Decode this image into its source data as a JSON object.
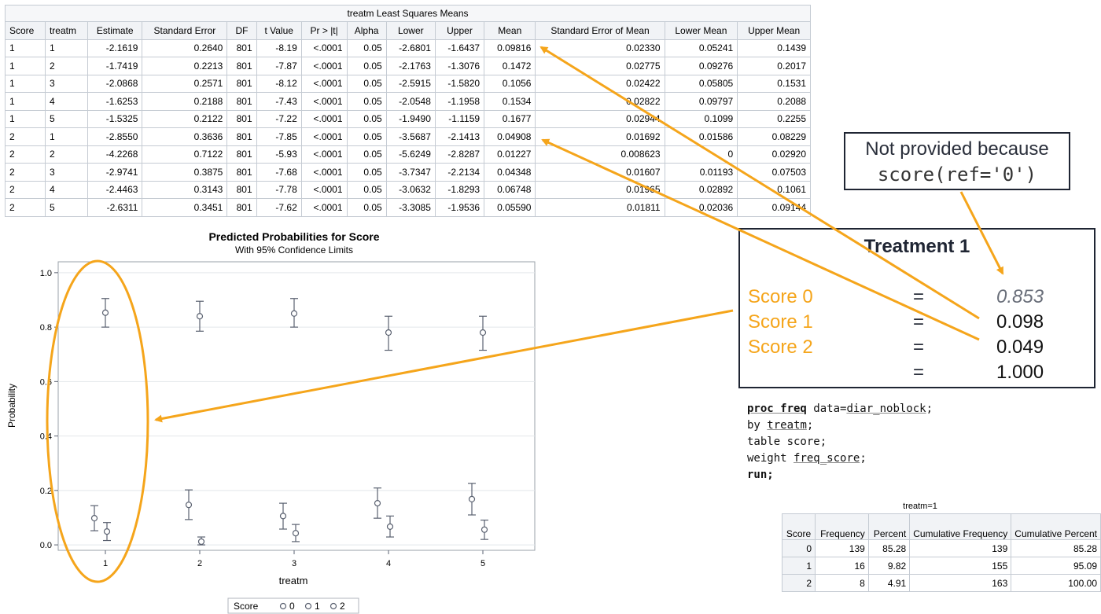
{
  "ls_table": {
    "title": "treatm Least Squares Means",
    "headers": [
      "Score",
      "treatm",
      "Estimate",
      "Standard Error",
      "DF",
      "t Value",
      "Pr > |t|",
      "Alpha",
      "Lower",
      "Upper",
      "Mean",
      "Standard Error of Mean",
      "Lower Mean",
      "Upper Mean"
    ],
    "rows": [
      [
        "1",
        "1",
        "-2.1619",
        "0.2640",
        "801",
        "-8.19",
        "<.0001",
        "0.05",
        "-2.6801",
        "-1.6437",
        "0.09816",
        "0.02330",
        "0.05241",
        "0.1439"
      ],
      [
        "1",
        "2",
        "-1.7419",
        "0.2213",
        "801",
        "-7.87",
        "<.0001",
        "0.05",
        "-2.1763",
        "-1.3076",
        "0.1472",
        "0.02775",
        "0.09276",
        "0.2017"
      ],
      [
        "1",
        "3",
        "-2.0868",
        "0.2571",
        "801",
        "-8.12",
        "<.0001",
        "0.05",
        "-2.5915",
        "-1.5820",
        "0.1056",
        "0.02422",
        "0.05805",
        "0.1531"
      ],
      [
        "1",
        "4",
        "-1.6253",
        "0.2188",
        "801",
        "-7.43",
        "<.0001",
        "0.05",
        "-2.0548",
        "-1.1958",
        "0.1534",
        "0.02822",
        "0.09797",
        "0.2088"
      ],
      [
        "1",
        "5",
        "-1.5325",
        "0.2122",
        "801",
        "-7.22",
        "<.0001",
        "0.05",
        "-1.9490",
        "-1.1159",
        "0.1677",
        "0.02944",
        "0.1099",
        "0.2255"
      ],
      [
        "2",
        "1",
        "-2.8550",
        "0.3636",
        "801",
        "-7.85",
        "<.0001",
        "0.05",
        "-3.5687",
        "-2.1413",
        "0.04908",
        "0.01692",
        "0.01586",
        "0.08229"
      ],
      [
        "2",
        "2",
        "-4.2268",
        "0.7122",
        "801",
        "-5.93",
        "<.0001",
        "0.05",
        "-5.6249",
        "-2.8287",
        "0.01227",
        "0.008623",
        "0",
        "0.02920"
      ],
      [
        "2",
        "3",
        "-2.9741",
        "0.3875",
        "801",
        "-7.68",
        "<.0001",
        "0.05",
        "-3.7347",
        "-2.2134",
        "0.04348",
        "0.01607",
        "0.01193",
        "0.07503"
      ],
      [
        "2",
        "4",
        "-2.4463",
        "0.3143",
        "801",
        "-7.78",
        "<.0001",
        "0.05",
        "-3.0632",
        "-1.8293",
        "0.06748",
        "0.01965",
        "0.02892",
        "0.1061"
      ],
      [
        "2",
        "5",
        "-2.6311",
        "0.3451",
        "801",
        "-7.62",
        "<.0001",
        "0.05",
        "-3.3085",
        "-1.9536",
        "0.05590",
        "0.01811",
        "0.02036",
        "0.09144"
      ]
    ]
  },
  "not_provided": {
    "line1": "Not provided because",
    "line2": "score(ref='0')"
  },
  "treatment_box": {
    "title": "Treatment 1",
    "rows": [
      {
        "label": "Score 0",
        "eq": "=",
        "value": "0.853"
      },
      {
        "label": "Score 1",
        "eq": "=",
        "value": "0.098"
      },
      {
        "label": "Score 2",
        "eq": "=",
        "value": "0.049"
      },
      {
        "label": "",
        "eq": "=",
        "value": "1.000"
      }
    ]
  },
  "code": {
    "line1_kw": "proc freq",
    "line1_rest": " data=",
    "line1_ds": "diar_noblock",
    "line1_end": ";",
    "line2_kw": "by ",
    "line2_var": "treatm",
    "line2_end": ";",
    "line3": "table score;",
    "line4_kw": "weight ",
    "line4_var": "freq_score",
    "line4_end": ";",
    "line5": "run;"
  },
  "freq_table": {
    "title": "treatm=1",
    "headers": [
      "Score",
      "Frequency",
      "Percent",
      "Cumulative Frequency",
      "Cumulative Percent"
    ],
    "rows": [
      [
        "0",
        "139",
        "85.28",
        "139",
        "85.28"
      ],
      [
        "1",
        "16",
        "9.82",
        "155",
        "95.09"
      ],
      [
        "2",
        "8",
        "4.91",
        "163",
        "100.00"
      ]
    ]
  },
  "colors": {
    "accent": "#f5a51b",
    "axis": "#5a6170",
    "border": "#c5cbd3"
  },
  "chart_data": {
    "type": "scatter",
    "title": "Predicted Probabilities for Score",
    "subtitle": "With 95% Confidence Limits",
    "xlabel": "treatm",
    "ylabel": "Probability",
    "categories": [
      "1",
      "2",
      "3",
      "4",
      "5"
    ],
    "ylim": [
      -0.02,
      1.04
    ],
    "yticks": [
      "0.0",
      "0.2",
      "0.4",
      "0.6",
      "0.8",
      "1.0"
    ],
    "grid": true,
    "legend_title": "Score",
    "legend_position": "bottom",
    "series": [
      {
        "name": "0",
        "values": [
          0.853,
          0.84,
          0.85,
          0.78,
          0.78
        ],
        "lower": [
          0.8,
          0.785,
          0.8,
          0.715,
          0.715
        ],
        "upper": [
          0.905,
          0.895,
          0.905,
          0.84,
          0.84
        ]
      },
      {
        "name": "1",
        "values": [
          0.098,
          0.147,
          0.106,
          0.153,
          0.168
        ],
        "lower": [
          0.052,
          0.093,
          0.058,
          0.098,
          0.11
        ],
        "upper": [
          0.144,
          0.202,
          0.153,
          0.209,
          0.226
        ]
      },
      {
        "name": "2",
        "values": [
          0.049,
          0.012,
          0.043,
          0.067,
          0.056
        ],
        "lower": [
          0.016,
          0.0,
          0.012,
          0.029,
          0.02
        ],
        "upper": [
          0.082,
          0.029,
          0.075,
          0.106,
          0.091
        ]
      }
    ]
  }
}
